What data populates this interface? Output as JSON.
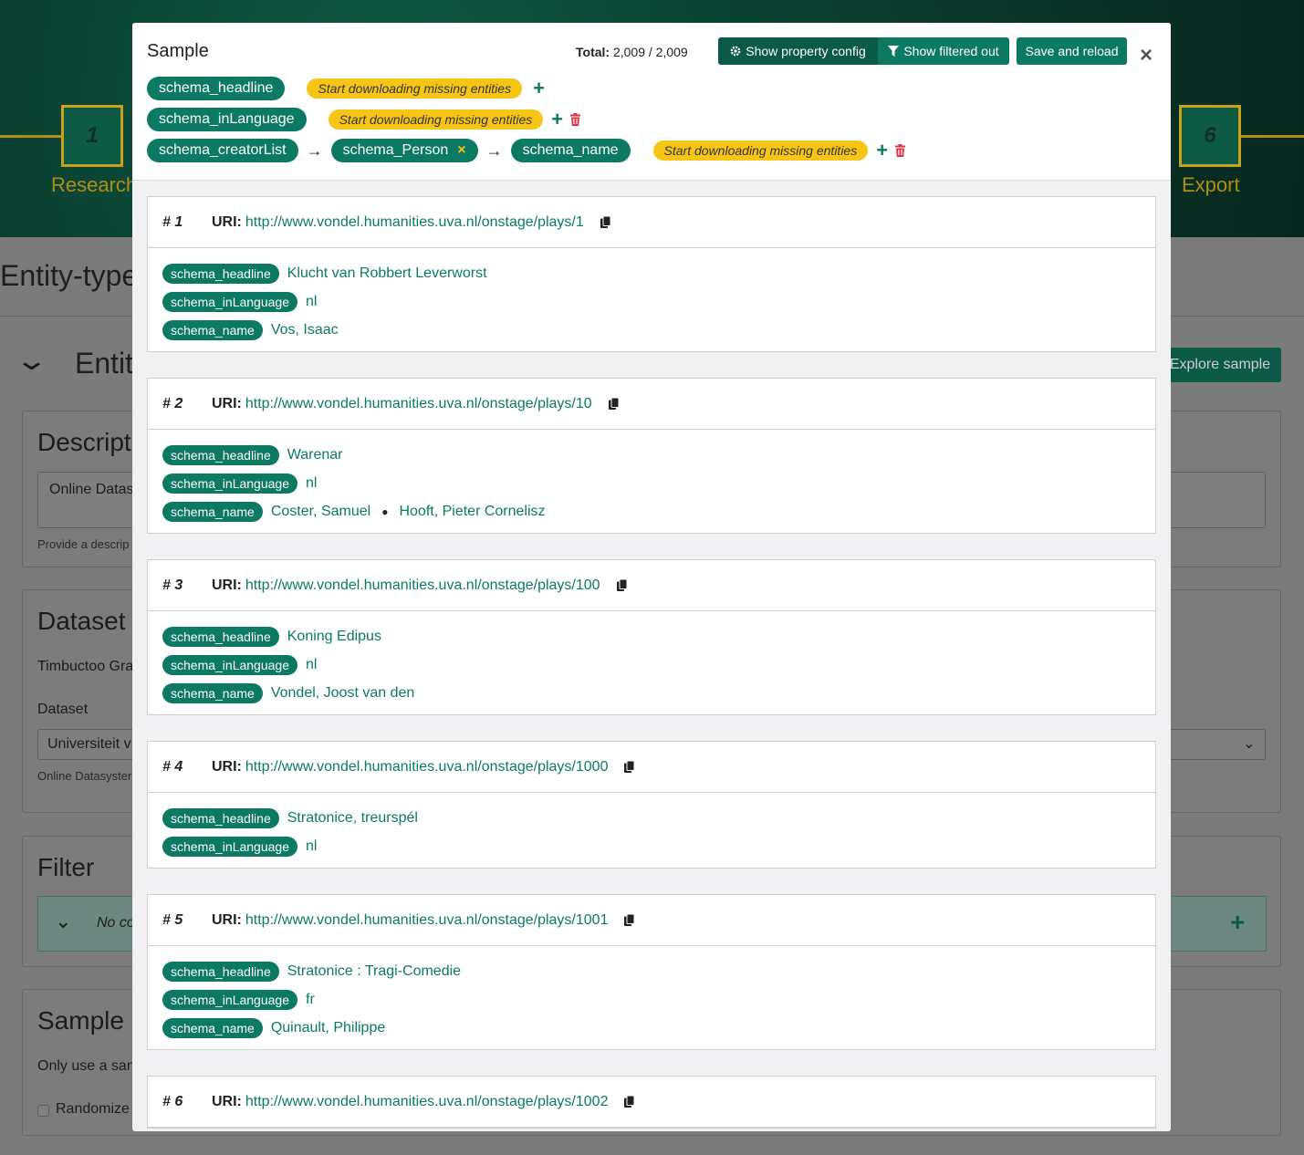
{
  "background": {
    "steps": [
      {
        "number": "1",
        "label": "Research"
      },
      {
        "number": "6",
        "label": "Export"
      }
    ],
    "page_title": "Entity-type",
    "section_title": "Entit",
    "explore_button": "Explore sample",
    "description": {
      "title": "Descript",
      "textarea_value": "Online Datas",
      "help": "Provide a descrip"
    },
    "dataset": {
      "title": "Dataset",
      "text": "Timbuctoo Gra",
      "field_label": "Dataset",
      "select_value": "Universiteit v",
      "help": "Online Datasyster"
    },
    "filter": {
      "title": "Filter",
      "placeholder": "No co"
    },
    "sample": {
      "title": "Sample",
      "text": "Only use a san",
      "checkbox_label": "Randomize"
    }
  },
  "modal": {
    "title": "Sample",
    "total_label": "Total:",
    "total_value": "2,009 / 2,009",
    "buttons": {
      "show_property_config": "Show property config",
      "show_filtered_out": "Show filtered out",
      "save_and_reload": "Save and reload"
    },
    "close": "×",
    "warning_label": "Start downloading missing entities",
    "property_paths": [
      [
        "schema_headline"
      ],
      [
        "schema_inLanguage"
      ],
      [
        "schema_creatorList",
        "schema_Person",
        "schema_name"
      ]
    ],
    "uri_label": "URI:",
    "results": [
      {
        "num": "# 1",
        "uri": "http://www.vondel.humanities.uva.nl/onstage/plays/1",
        "props": [
          {
            "name": "schema_headline",
            "values": [
              "Klucht van Robbert Leverworst"
            ]
          },
          {
            "name": "schema_inLanguage",
            "values": [
              "nl"
            ]
          },
          {
            "name": "schema_name",
            "values": [
              "Vos, Isaac"
            ]
          }
        ]
      },
      {
        "num": "# 2",
        "uri": "http://www.vondel.humanities.uva.nl/onstage/plays/10",
        "props": [
          {
            "name": "schema_headline",
            "values": [
              "Warenar"
            ]
          },
          {
            "name": "schema_inLanguage",
            "values": [
              "nl"
            ]
          },
          {
            "name": "schema_name",
            "values": [
              "Coster, Samuel",
              "Hooft, Pieter Cornelisz"
            ]
          }
        ]
      },
      {
        "num": "# 3",
        "uri": "http://www.vondel.humanities.uva.nl/onstage/plays/100",
        "props": [
          {
            "name": "schema_headline",
            "values": [
              "Koning Edipus"
            ]
          },
          {
            "name": "schema_inLanguage",
            "values": [
              "nl"
            ]
          },
          {
            "name": "schema_name",
            "values": [
              "Vondel, Joost van den"
            ]
          }
        ]
      },
      {
        "num": "# 4",
        "uri": "http://www.vondel.humanities.uva.nl/onstage/plays/1000",
        "props": [
          {
            "name": "schema_headline",
            "values": [
              "Stratonice, treurspél"
            ]
          },
          {
            "name": "schema_inLanguage",
            "values": [
              "nl"
            ]
          }
        ]
      },
      {
        "num": "# 5",
        "uri": "http://www.vondel.humanities.uva.nl/onstage/plays/1001",
        "props": [
          {
            "name": "schema_headline",
            "values": [
              "Stratonice : Tragi-Comedie"
            ]
          },
          {
            "name": "schema_inLanguage",
            "values": [
              "fr"
            ]
          },
          {
            "name": "schema_name",
            "values": [
              "Quinault, Philippe"
            ]
          }
        ]
      },
      {
        "num": "# 6",
        "uri": "http://www.vondel.humanities.uva.nl/onstage/plays/1002",
        "props": []
      }
    ]
  },
  "colors": {
    "brand": "#0c7a62",
    "warning": "#f7c516",
    "danger": "#dc3545"
  }
}
